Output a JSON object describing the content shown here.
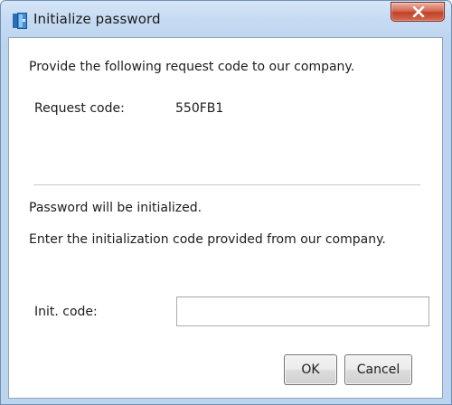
{
  "window": {
    "title": "Initialize password",
    "close_icon": "close-x-icon",
    "app_icon": "app-icon"
  },
  "request_section": {
    "instruction": "Provide the following request code to our company.",
    "request_code_label": "Request code:",
    "request_code_value": "550FB1"
  },
  "init_section": {
    "notice": "Password will be initialized.",
    "instruction": "Enter the initialization code provided from our company.",
    "init_code_label": "Init. code:",
    "init_code_value": "",
    "init_code_placeholder": ""
  },
  "buttons": {
    "ok_label": "OK",
    "cancel_label": "Cancel"
  },
  "colors": {
    "close_button": "#c7462f",
    "window_frame": "#bcd4ee"
  }
}
